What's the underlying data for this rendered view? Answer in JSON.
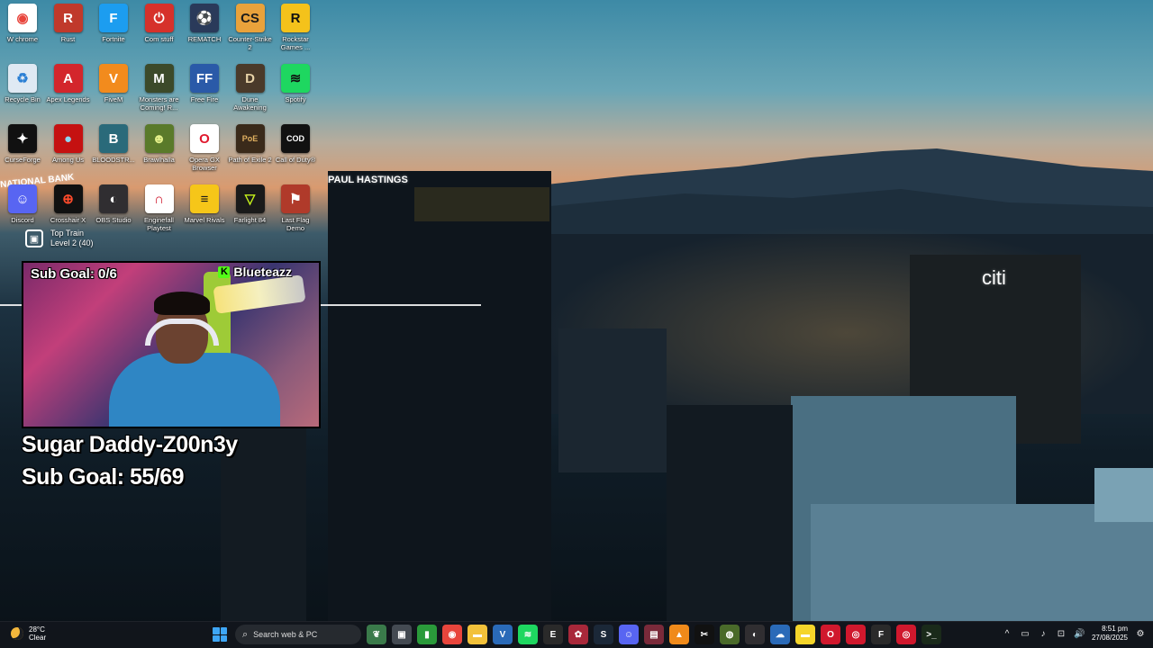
{
  "desktop_icons": [
    {
      "label": "W chrome",
      "glyph": "◉",
      "bg": "#ffffff",
      "fg": "#e8453c"
    },
    {
      "label": "Rust",
      "glyph": "R",
      "bg": "#c0392b",
      "fg": "#ffffff"
    },
    {
      "label": "Fortnite",
      "glyph": "F",
      "bg": "#1c9df0",
      "fg": "#ffffff"
    },
    {
      "label": "Com stuff",
      "glyph": "⏻",
      "bg": "#d6312b",
      "fg": "#ffffff"
    },
    {
      "label": "REMATCH",
      "glyph": "⚽",
      "bg": "#2a3a5a",
      "fg": "#ffffff"
    },
    {
      "label": "Counter-Strike 2",
      "glyph": "CS",
      "bg": "#e9a23b",
      "fg": "#1b1b1b"
    },
    {
      "label": "Rockstar Games ...",
      "glyph": "R",
      "bg": "#f4c21b",
      "fg": "#111111"
    },
    {
      "label": "Recycle Bin",
      "glyph": "♻",
      "bg": "#dfe9f3",
      "fg": "#2a7fd4"
    },
    {
      "label": "Apex Legends",
      "glyph": "A",
      "bg": "#d3262c",
      "fg": "#ffffff"
    },
    {
      "label": "FiveM",
      "glyph": "V",
      "bg": "#f28b1d",
      "fg": "#ffffff"
    },
    {
      "label": "Monsters are Coming! R...",
      "glyph": "M",
      "bg": "#3c4a2a",
      "fg": "#ffffff"
    },
    {
      "label": "Free Fire",
      "glyph": "FF",
      "bg": "#2a5aa8",
      "fg": "#ffffff"
    },
    {
      "label": "Dune Awakening",
      "glyph": "D",
      "bg": "#4a3a2a",
      "fg": "#e8d3a8"
    },
    {
      "label": "Spotify",
      "glyph": "≋",
      "bg": "#1ed760",
      "fg": "#111111"
    },
    {
      "label": "CurseForge",
      "glyph": "✦",
      "bg": "#111111",
      "fg": "#ffffff"
    },
    {
      "label": "Among Us",
      "glyph": "●",
      "bg": "#c51111",
      "fg": "#8ed6f0"
    },
    {
      "label": "BLOODSTR...",
      "glyph": "B",
      "bg": "#2a6a7a",
      "fg": "#ffffff"
    },
    {
      "label": "Brawlhalla",
      "glyph": "☻",
      "bg": "#5a7a2a",
      "fg": "#e4f08a"
    },
    {
      "label": "Opera GX Browser",
      "glyph": "O",
      "bg": "#ffffff",
      "fg": "#e0182d"
    },
    {
      "label": "Path of Exile 2",
      "glyph": "PoE",
      "bg": "#3a2a1a",
      "fg": "#e0b060"
    },
    {
      "label": "Call of Duty®",
      "glyph": "COD",
      "bg": "#111111",
      "fg": "#ffffff"
    },
    {
      "label": "Discord",
      "glyph": "☺",
      "bg": "#5865f2",
      "fg": "#ffffff"
    },
    {
      "label": "Crosshair X",
      "glyph": "⊕",
      "bg": "#111111",
      "fg": "#ff4b2b"
    },
    {
      "label": "OBS Studio",
      "glyph": "◐",
      "bg": "#302e31",
      "fg": "#ffffff"
    },
    {
      "label": "Enginefall Playtest",
      "glyph": "∩",
      "bg": "#ffffff",
      "fg": "#d0182d"
    },
    {
      "label": "Marvel Rivals",
      "glyph": "≡",
      "bg": "#f6c619",
      "fg": "#1a1a1a"
    },
    {
      "label": "Farlight 84",
      "glyph": "▽",
      "bg": "#1a1a1a",
      "fg": "#c6f21a"
    },
    {
      "label": "Last Flag Demo",
      "glyph": "⚑",
      "bg": "#b03a2a",
      "fg": "#ffffff"
    }
  ],
  "top_train": {
    "line1": "Top Train",
    "line2": "Level 2 (40)"
  },
  "webcam": {
    "sub_goal": "Sub Goal: 0/6",
    "brand": "Blueteazz",
    "kick_glyph": "K"
  },
  "overlay": {
    "line1": "Sugar Daddy-Z00n3y",
    "line2": "Sub Goal: 55/69"
  },
  "signs": {
    "paul_hastings": "PAUL HASTINGS",
    "citi": "citi",
    "national_bank": "NATIONAL BANK"
  },
  "taskbar": {
    "weather_temp": "28°C",
    "weather_desc": "Clear",
    "search_placeholder": "Search web & PC",
    "apps": [
      {
        "name": "leaf-widget",
        "glyph": "❦",
        "bg": "#3a7a4a"
      },
      {
        "name": "task-view",
        "glyph": "▣",
        "bg": "#444a52"
      },
      {
        "name": "xbox",
        "glyph": "▮",
        "bg": "#2a9a3a"
      },
      {
        "name": "chrome",
        "glyph": "◉",
        "bg": "#e8453c"
      },
      {
        "name": "file-explorer",
        "glyph": "▬",
        "bg": "#f2c13a"
      },
      {
        "name": "visual-studio",
        "glyph": "V",
        "bg": "#2a6ab8"
      },
      {
        "name": "spotify",
        "glyph": "≋",
        "bg": "#1ed760"
      },
      {
        "name": "epic-games",
        "glyph": "E",
        "bg": "#2a2a2a"
      },
      {
        "name": "red-app",
        "glyph": "✿",
        "bg": "#a8283a"
      },
      {
        "name": "steam",
        "glyph": "S",
        "bg": "#1b2838"
      },
      {
        "name": "discord",
        "glyph": "☺",
        "bg": "#5865f2"
      },
      {
        "name": "photo-app",
        "glyph": "▤",
        "bg": "#7a2a3a"
      },
      {
        "name": "vlc",
        "glyph": "▲",
        "bg": "#f08a1a"
      },
      {
        "name": "capcut",
        "glyph": "✂",
        "bg": "#111111"
      },
      {
        "name": "green-app",
        "glyph": "◍",
        "bg": "#4a6a2a"
      },
      {
        "name": "obs",
        "glyph": "◐",
        "bg": "#302e31"
      },
      {
        "name": "weather-app",
        "glyph": "☁",
        "bg": "#2a6ab8"
      },
      {
        "name": "sticky-notes",
        "glyph": "▬",
        "bg": "#f5d52a"
      },
      {
        "name": "opera-gx",
        "glyph": "O",
        "bg": "#d0182d"
      },
      {
        "name": "red-app-2",
        "glyph": "◎",
        "bg": "#d0182d"
      },
      {
        "name": "faceit",
        "glyph": "F",
        "bg": "#2a2a2a"
      },
      {
        "name": "red-app-3",
        "glyph": "◎",
        "bg": "#d0182d"
      },
      {
        "name": "terminal",
        "glyph": ">_",
        "bg": "#1a2a1a"
      }
    ],
    "tray": [
      "^",
      "▭",
      "♪",
      "⊡",
      "🔊"
    ],
    "time": "8:51 pm",
    "date": "27/08/2025"
  },
  "colors": {
    "accent": "#3ea6f5",
    "kick_green": "#53fc18"
  }
}
